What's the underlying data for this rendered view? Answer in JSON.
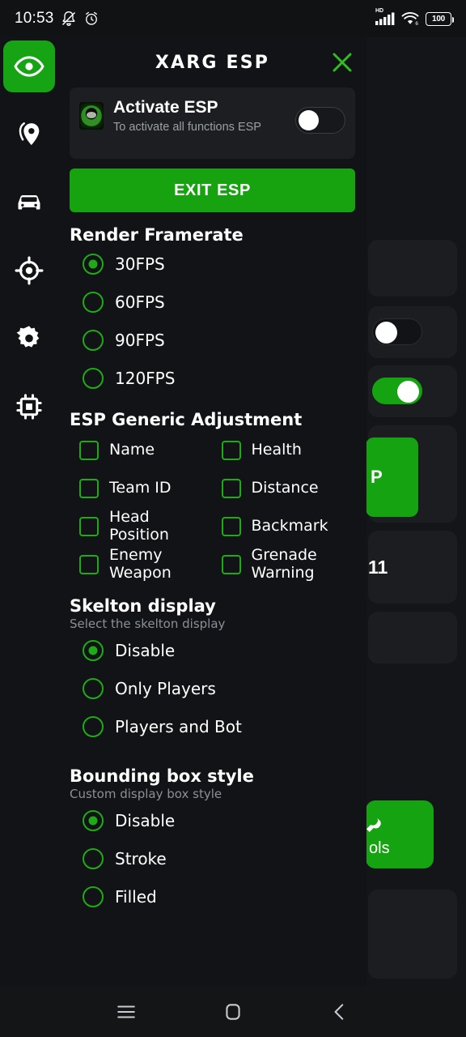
{
  "status_bar": {
    "time": "10:53",
    "battery": "100",
    "network_label": "HD",
    "icons": [
      "mute-bell-icon",
      "alarm-clock-icon",
      "signal-bars-icon",
      "wifi-icon",
      "battery-icon"
    ]
  },
  "rail": {
    "items": [
      {
        "name": "eye-icon",
        "active": true
      },
      {
        "name": "location-pin-icon",
        "active": false
      },
      {
        "name": "car-icon",
        "active": false
      },
      {
        "name": "target-crosshair-icon",
        "active": false
      },
      {
        "name": "gear-icon",
        "active": false
      },
      {
        "name": "chip-icon",
        "active": false
      }
    ]
  },
  "sheet": {
    "title": "XARG ESP",
    "close_icon": "close-icon",
    "activate_card": {
      "title": "Activate ESP",
      "subtitle": "To activate all functions ESP",
      "toggle_on": false,
      "logo_icon": "app-logo-icon"
    },
    "exit_button": "EXIT ESP",
    "sections": [
      {
        "id": "render-framerate",
        "title": "Render Framerate",
        "subtitle": "",
        "type": "radio",
        "selected": 0,
        "options": [
          "30FPS",
          "60FPS",
          "90FPS",
          "120FPS"
        ]
      },
      {
        "id": "esp-generic-adjustment",
        "title": "ESP Generic Adjustment",
        "subtitle": "",
        "type": "checkbox",
        "options": [
          {
            "label": "Name",
            "checked": false
          },
          {
            "label": "Health",
            "checked": false
          },
          {
            "label": "Team ID",
            "checked": false
          },
          {
            "label": "Distance",
            "checked": false
          },
          {
            "label": "Head Position",
            "checked": false
          },
          {
            "label": "Backmark",
            "checked": false
          },
          {
            "label": "Enemy Weapon",
            "checked": false
          },
          {
            "label": "Grenade Warning",
            "checked": false
          }
        ]
      },
      {
        "id": "skelton-display",
        "title": "Skelton display",
        "subtitle": "Select the skelton display",
        "type": "radio",
        "selected": 0,
        "options": [
          "Disable",
          "Only Players",
          "Players and Bot"
        ]
      },
      {
        "id": "bounding-box-style",
        "title": "Bounding box style",
        "subtitle": "Custom display box style",
        "type": "radio",
        "selected": 0,
        "options": [
          "Disable",
          "Stroke",
          "Filled"
        ]
      }
    ]
  },
  "background": {
    "clipped_text": "11",
    "clipped_button_text": "P",
    "tools_label": "ols",
    "toggles": [
      {
        "state": "off"
      },
      {
        "state": "on"
      }
    ]
  },
  "navbar": {
    "items": [
      {
        "name": "recents-icon"
      },
      {
        "name": "home-icon"
      },
      {
        "name": "back-icon"
      }
    ]
  },
  "colors": {
    "accent_green": "#16a30f",
    "outline_green": "#1faa18",
    "sheet_bg": "#121316",
    "card_bg": "#1c1e21",
    "page_bg": "#141518",
    "muted_text": "#8b9096"
  }
}
